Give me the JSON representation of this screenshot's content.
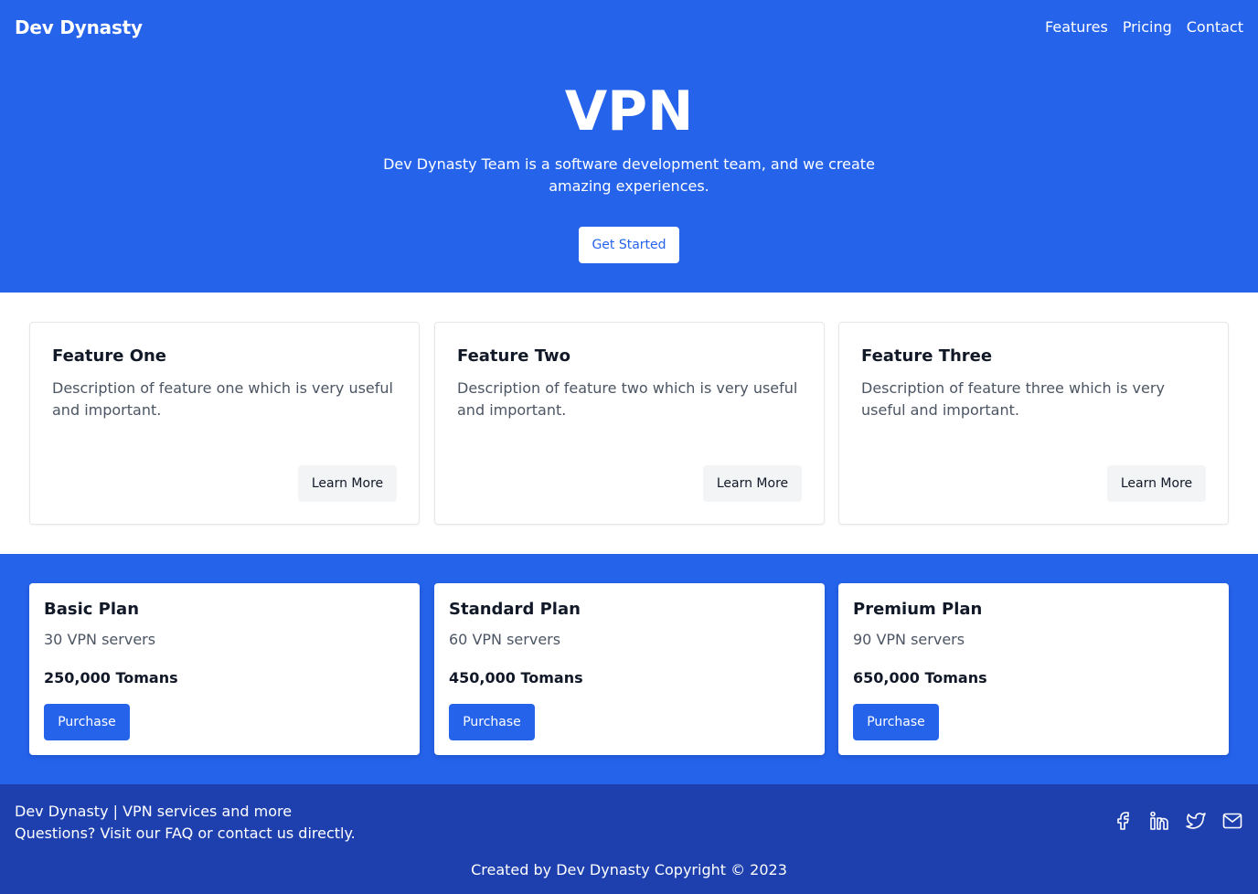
{
  "header": {
    "brand": "Dev Dynasty",
    "nav": [
      "Features",
      "Pricing",
      "Contact"
    ]
  },
  "hero": {
    "title": "VPN",
    "description": "Dev Dynasty Team is a software development team, and we create amazing experiences.",
    "cta_label": "Get Started"
  },
  "features": [
    {
      "title": "Feature One",
      "description": "Description of feature one which is very useful and important.",
      "button": "Learn More"
    },
    {
      "title": "Feature Two",
      "description": "Description of feature two which is very useful and important.",
      "button": "Learn More"
    },
    {
      "title": "Feature Three",
      "description": "Description of feature three which is very useful and important.",
      "button": "Learn More"
    }
  ],
  "plans": [
    {
      "name": "Basic Plan",
      "servers": "30 VPN servers",
      "price": "250,000 Tomans",
      "button": "Purchase"
    },
    {
      "name": "Standard Plan",
      "servers": "60 VPN servers",
      "price": "450,000 Tomans",
      "button": "Purchase"
    },
    {
      "name": "Premium Plan",
      "servers": "90 VPN servers",
      "price": "650,000 Tomans",
      "button": "Purchase"
    }
  ],
  "footer": {
    "line1": "Dev Dynasty | VPN services and more",
    "line2": "Questions? Visit our FAQ or contact us directly.",
    "socials": [
      "facebook-icon",
      "linkedin-icon",
      "twitter-icon",
      "mail-icon"
    ],
    "copyright": "Created by Dev Dynasty Copyright © 2023"
  },
  "colors": {
    "primary": "#2563eb",
    "footer_bg": "#1e40af",
    "muted_text": "#4b5563",
    "secondary_button": "#f3f4f6"
  }
}
